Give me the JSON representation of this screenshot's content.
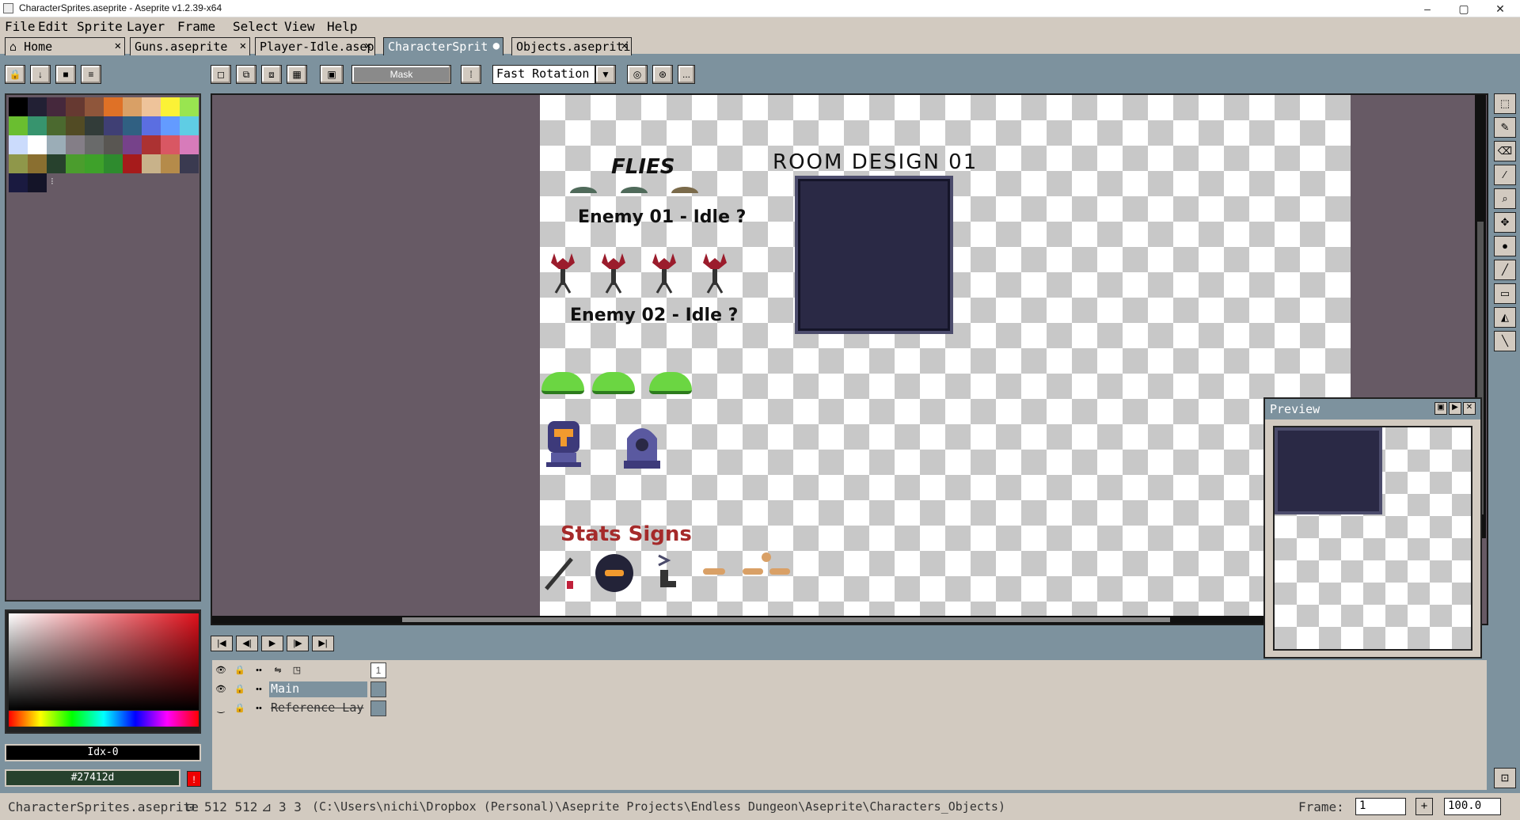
{
  "window": {
    "title": "CharacterSprites.aseprite - Aseprite v1.2.39-x64",
    "controls": [
      "–",
      "▢",
      "✕"
    ]
  },
  "menu": [
    "File",
    "Edit",
    "Sprite",
    "Layer",
    "Frame",
    "Select",
    "View",
    "Help"
  ],
  "tabs": [
    {
      "label": "Home",
      "icon": "home-icon",
      "close": "✕",
      "active": false
    },
    {
      "label": "Guns.aseprite",
      "close": "✕",
      "active": false
    },
    {
      "label": "Player-Idle.asep",
      "close": "✕",
      "active": false
    },
    {
      "label": "CharacterSprit",
      "close": "●",
      "active": true
    },
    {
      "label": "Objects.asepriti",
      "close": "✕",
      "active": false
    }
  ],
  "toolbar": {
    "mask_label": "Mask",
    "rotation_algorithm": "Fast Rotation",
    "more_label": "..."
  },
  "palette": {
    "colors": [
      "#000000",
      "#222034",
      "#45283c",
      "#663931",
      "#8f563b",
      "#df7126",
      "#d9a066",
      "#eec39a",
      "#fbf236",
      "#99e550",
      "#6abe30",
      "#37946e",
      "#4b692f",
      "#524b24",
      "#323c39",
      "#3f3f74",
      "#306082",
      "#5b6ee1",
      "#639bff",
      "#5fcde4",
      "#cbdbfc",
      "#ffffff",
      "#9badb7",
      "#847e87",
      "#696a6a",
      "#595652",
      "#76428a",
      "#ac3232",
      "#d95763",
      "#d77bba",
      "#8f974a",
      "#8a6f30",
      "#27412d",
      "#4b9d2d",
      "#3ea12a",
      "#2e8b2e",
      "#a61b1b",
      "#c8b28a",
      "#b58b4a",
      "#3a3a50",
      "#1a1a40",
      "#141428"
    ]
  },
  "color_bar": {
    "index_label": "Idx-0",
    "hex_label": "#27412d",
    "fg_color": "#27412d"
  },
  "canvas": {
    "flies_label": "FLIES",
    "enemy01_label": "Enemy 01 - Idle ?",
    "enemy02_label": "Enemy 02 - Idle ?",
    "room_label": "ROOM DESIGN 01",
    "stats_label": "Stats Signs"
  },
  "preview": {
    "title": "Preview"
  },
  "timeline": {
    "frame_number": "1",
    "layers": [
      {
        "name": "Main",
        "visible": true
      },
      {
        "name": "Reference Lay",
        "visible": false
      }
    ]
  },
  "status": {
    "filename": "CharacterSprites.aseprite",
    "size": "512 512",
    "grid": "3 3",
    "path": "(C:\\Users\\nichi\\Dropbox (Personal)\\Aseprite Projects\\Endless Dungeon\\Aseprite\\Characters_Objects)",
    "frame_label": "Frame:",
    "frame_value": "1",
    "zoom": "100.0"
  }
}
